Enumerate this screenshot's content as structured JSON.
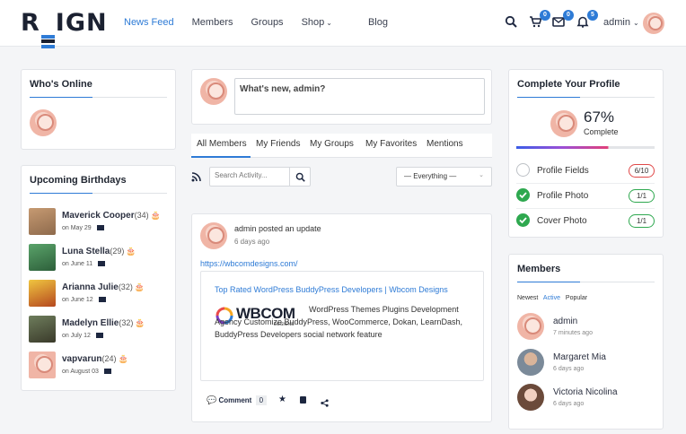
{
  "brand": {
    "logo": "REIGN",
    "accent": "#2e7bd6"
  },
  "nav": {
    "items": [
      "News Feed",
      "Members",
      "Groups",
      "Shop",
      "Blog"
    ],
    "active": "News Feed"
  },
  "header": {
    "cart_count": "0",
    "messages_count": "0",
    "notifications_count": "5",
    "user": "admin"
  },
  "whos_online": {
    "title": "Who's Online"
  },
  "birthdays": {
    "title": "Upcoming Birthdays",
    "people": [
      {
        "name": "Maverick Cooper",
        "age": "(34)",
        "date": "on May 29"
      },
      {
        "name": "Luna Stella",
        "age": "(29)",
        "date": "on June 11"
      },
      {
        "name": "Arianna Julie",
        "age": "(32)",
        "date": "on June 12"
      },
      {
        "name": "Madelyn Ellie",
        "age": "(32)",
        "date": "on July 12"
      },
      {
        "name": "vapvarun",
        "age": "(24)",
        "date": "on August 03"
      }
    ]
  },
  "composer": {
    "placeholder": "What's new, admin?"
  },
  "activity_tabs": [
    "All Members",
    "My Friends",
    "My Groups",
    "My Favorites",
    "Mentions"
  ],
  "activity_search": {
    "placeholder": "Search Activity..."
  },
  "filter": {
    "selected": "— Everything —"
  },
  "post": {
    "author": "admin",
    "action": "posted an update",
    "time": "6 days ago",
    "url": "https://wbcomdesigns.com/",
    "preview_title": "Top Rated WordPress BuddyPress Developers | Wbcom Designs",
    "preview_logo": "WBCOM",
    "preview_logo_sub": "DESIGNS",
    "preview_text": "WordPress Themes Plugins Development Agency Customize BuddyPress, WooCommerce, Dokan, LearnDash, BuddyPress Developers social network feature",
    "comment_label": "Comment",
    "comment_count": "0"
  },
  "profile": {
    "title": "Complete Your Profile",
    "percent": "67%",
    "percent_value": 67,
    "complete_label": "Complete",
    "items": [
      {
        "label": "Profile Fields",
        "value": "6/10",
        "done": false
      },
      {
        "label": "Profile Photo",
        "value": "1/1",
        "done": true
      },
      {
        "label": "Cover Photo",
        "value": "1/1",
        "done": true
      }
    ]
  },
  "members": {
    "title": "Members",
    "filters": [
      "Newest",
      "Active",
      "Popular"
    ],
    "active_filter": "Active",
    "list": [
      {
        "name": "admin",
        "time": "7 minutes ago"
      },
      {
        "name": "Margaret Mia",
        "time": "6 days ago"
      },
      {
        "name": "Victoria Nicolina",
        "time": "6 days ago"
      }
    ]
  }
}
